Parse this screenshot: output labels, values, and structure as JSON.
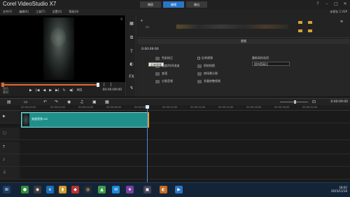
{
  "titlebar": {
    "app_title": "Corel VideoStudio X7",
    "tabs": [
      "捕获",
      "编辑",
      "输出"
    ],
    "active_tab": "编辑"
  },
  "menubar": {
    "items": [
      "文件(F)",
      "编辑(E)",
      "工具(T)",
      "设置(S)",
      "帮助(H)"
    ],
    "right": "未保存 1.VSP"
  },
  "preview": {
    "timecode": "00:00:09:00",
    "mode_labels": [
      "项目",
      "素材"
    ],
    "corner_marker": "4"
  },
  "options_panel": {
    "header": "视频",
    "timecode": "0:00:09:00",
    "tooltip": "反转视频",
    "rows_left": [
      "色彩校正",
      "速度/时间流逝",
      "变速",
      "分割音频",
      "按场景分割",
      "多重修整视频"
    ],
    "rows_right_checkbox": [
      "反转视频",
      "抓拍快照"
    ],
    "rows_right_group": "重新采样选项",
    "select_value": "保持宽高比"
  },
  "timeline": {
    "timecode": "0:00:09:00",
    "ruler_ticks": [
      "00:00:00:00",
      "00:00:02:00",
      "00:00:04:00",
      "00:00:06:00",
      "00:00:08:00",
      "00:00:10:00",
      "00:00:12:00",
      "00:00:14:00",
      "00:00:16:00",
      "00:00:18:00",
      "00:00:20:00"
    ],
    "clip_name": "鬼屋视频.avi"
  },
  "taskbar": {
    "time": "18:02",
    "date": "2015/11/10"
  },
  "colors": {
    "accent": "#2a76c6",
    "clip": "#1f8f8b",
    "scrubber": "#e06a2a"
  }
}
